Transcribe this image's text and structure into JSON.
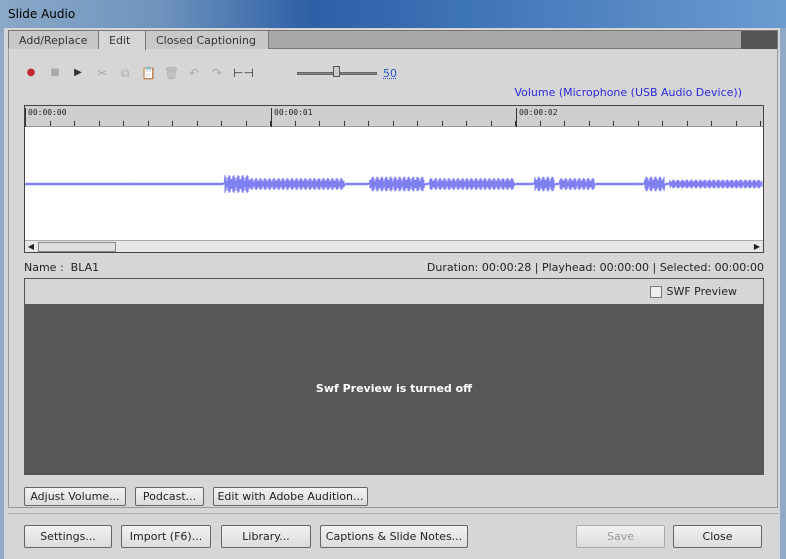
{
  "window": {
    "title": "Slide Audio"
  },
  "tabs": [
    {
      "label": "Add/Replace"
    },
    {
      "label": "Edit"
    },
    {
      "label": "Closed Captioning"
    }
  ],
  "toolbar": {
    "icons": [
      "record-icon",
      "stop-icon",
      "play-icon",
      "cut-icon",
      "copy-icon",
      "paste-icon",
      "delete-icon",
      "undo-icon",
      "redo-icon",
      "fit-icon"
    ],
    "volume_value": "50",
    "colors": {
      "record": "#c0282d",
      "play": "#333333"
    }
  },
  "volume_label": "Volume (Microphone (USB Audio Device))",
  "timeline": {
    "ticks": [
      "00:00:00",
      "00:00:01",
      "00:00:02"
    ],
    "waveform_color": "#7f7ff0"
  },
  "info": {
    "name_label": "Name :",
    "name": "BLA1",
    "duration_label": "Duration:",
    "duration": "00:00:28",
    "playhead_label": "| Playhead:",
    "playhead": "00:00:00",
    "selected_label": "| Selected:",
    "selected": "00:00:00"
  },
  "preview": {
    "checkbox_label": "SWF Preview",
    "checked": false,
    "message": "Swf Preview is turned off"
  },
  "edit_buttons": {
    "adjust": "Adjust Volume...",
    "podcast": "Podcast...",
    "audition": "Edit with Adobe Audition..."
  },
  "footer": {
    "settings": "Settings...",
    "import": "Import (F6)...",
    "library": "Library...",
    "captions": "Captions & Slide Notes...",
    "save": "Save",
    "close": "Close"
  }
}
